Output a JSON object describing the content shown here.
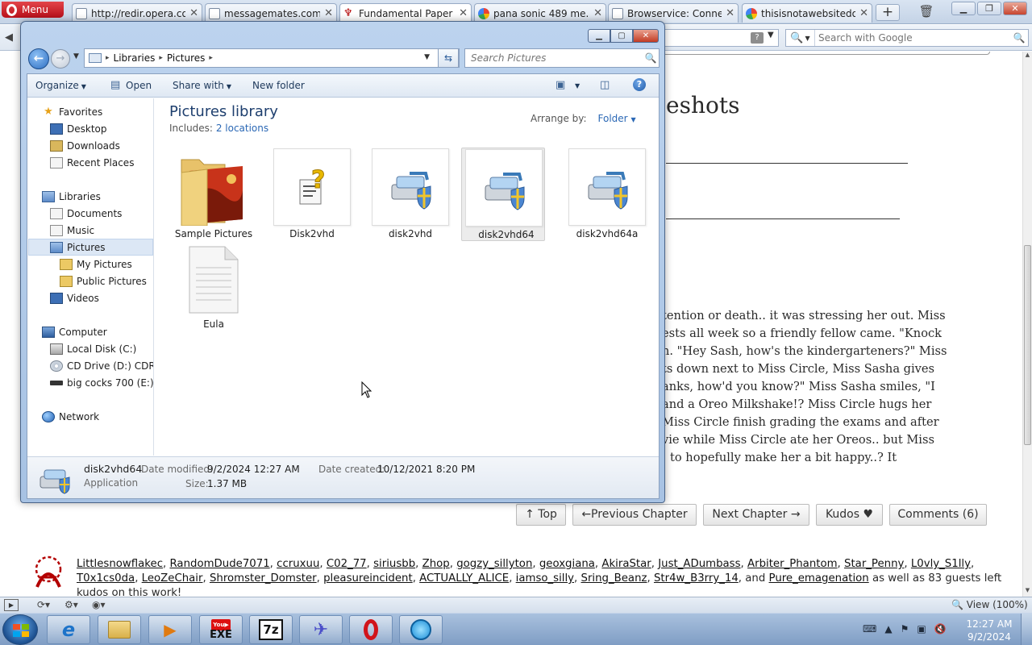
{
  "browser": {
    "menu_label": "Menu",
    "tabs": [
      {
        "label": "http://redir.opera.co...",
        "icon": "page-icon"
      },
      {
        "label": "messagemates.com",
        "icon": "page-icon"
      },
      {
        "label": "Fundamental Paper ...",
        "icon": "ao3-icon",
        "active": true
      },
      {
        "label": "pana sonic 489 me......",
        "icon": "google-icon"
      },
      {
        "label": "Browservice: Conne...",
        "icon": "page-icon"
      },
      {
        "label": "thisisnotawebsitedo...",
        "icon": "google-icon"
      }
    ],
    "search_placeholder": "Search with Google",
    "status_view": "View (100%)"
  },
  "webpage": {
    "title_fragment": "eshots",
    "story_lines": [
      "tention or death.. it was stressing her out. Miss",
      "ests all week so a friendly fellow came. \"Knock",
      "n. \"Hey Sash, how's the kindergarteners?\" Miss",
      "ts down next to Miss Circle, Miss Sasha gives",
      "anks, how'd you know?\" Miss Sasha smiles, \"I",
      "and a Oreo Milkshake!? Miss Circle hugs her",
      "Miss Circle finish grading the exams and after",
      "vie while Miss Circle ate her Oreos.. but Miss",
      "to hopefully make her a bit happy..? It"
    ],
    "nav_buttons": [
      "↑ Top",
      "←Previous Chapter",
      "Next Chapter →",
      "Kudos ♥",
      "Comments (6)"
    ],
    "kudos_users": [
      "Littlesnowflakec",
      "RandomDude7071",
      "ccruxuu",
      "C02_77",
      "siriusbb",
      "Zhop",
      "gogzy_sillyton",
      "geoxgiana",
      "AkiraStar",
      "Just_ADumbass",
      "Arbiter_Phantom",
      "Star_Penny",
      "L0vly_S1lly",
      "T0x1cs0da",
      "LeoZeChair",
      "Shromster_Domster",
      "pleasureincident",
      "ACTUALLY_ALICE",
      "iamso_silly",
      "Sring_Beanz",
      "Str4w_B3rry_14",
      "Pure_emagenation"
    ],
    "kudos_and": "and",
    "kudos_tail1": "as",
    "kudos_tail2": "well as 83 guests left kudos on this work!"
  },
  "explorer": {
    "breadcrumb": [
      "Libraries",
      "Pictures"
    ],
    "search_placeholder": "Search Pictures",
    "commands": {
      "organize": "Organize",
      "open": "Open",
      "share_with": "Share with",
      "new_folder": "New folder"
    },
    "tree": {
      "favorites": "Favorites",
      "desktop": "Desktop",
      "downloads": "Downloads",
      "recent_places": "Recent Places",
      "libraries": "Libraries",
      "documents": "Documents",
      "music": "Music",
      "pictures": "Pictures",
      "my_pictures": "My Pictures",
      "public_pictures": "Public Pictures",
      "videos": "Videos",
      "computer": "Computer",
      "local_disk": "Local Disk (C:)",
      "cd_drive": "CD Drive (D:) CDROM",
      "usb_drive": "big cocks 700 (E:)",
      "network": "Network"
    },
    "library_title": "Pictures library",
    "includes_label": "Includes:",
    "includes_link": "2 locations",
    "arrange_label": "Arrange by:",
    "arrange_value": "Folder",
    "files": [
      {
        "name": "Sample Pictures",
        "kind": "folder"
      },
      {
        "name": "Disk2vhd",
        "kind": "unknown-file"
      },
      {
        "name": "disk2vhd",
        "kind": "application"
      },
      {
        "name": "disk2vhd64",
        "kind": "application",
        "selected": true
      },
      {
        "name": "disk2vhd64a",
        "kind": "application"
      },
      {
        "name": "Eula",
        "kind": "text-file"
      }
    ],
    "details": {
      "name": "disk2vhd64",
      "type": "Application",
      "modified_label": "Date modified:",
      "modified_value": "9/2/2024 12:27 AM",
      "created_label": "Date created:",
      "created_value": "10/12/2021 8:20 PM",
      "size_label": "Size:",
      "size_value": "1.37 MB"
    }
  },
  "taskbar": {
    "pinned": [
      "internet-explorer-icon",
      "explorer-folder-icon",
      "media-player-icon",
      "youtube-exe-icon",
      "7zip-icon",
      "bird-app-icon",
      "opera-icon",
      "compass-app-icon"
    ],
    "youtube_label": "EXE",
    "sevenzip_label": "7z",
    "clock_time": "12:27 AM",
    "clock_date": "9/2/2024"
  }
}
